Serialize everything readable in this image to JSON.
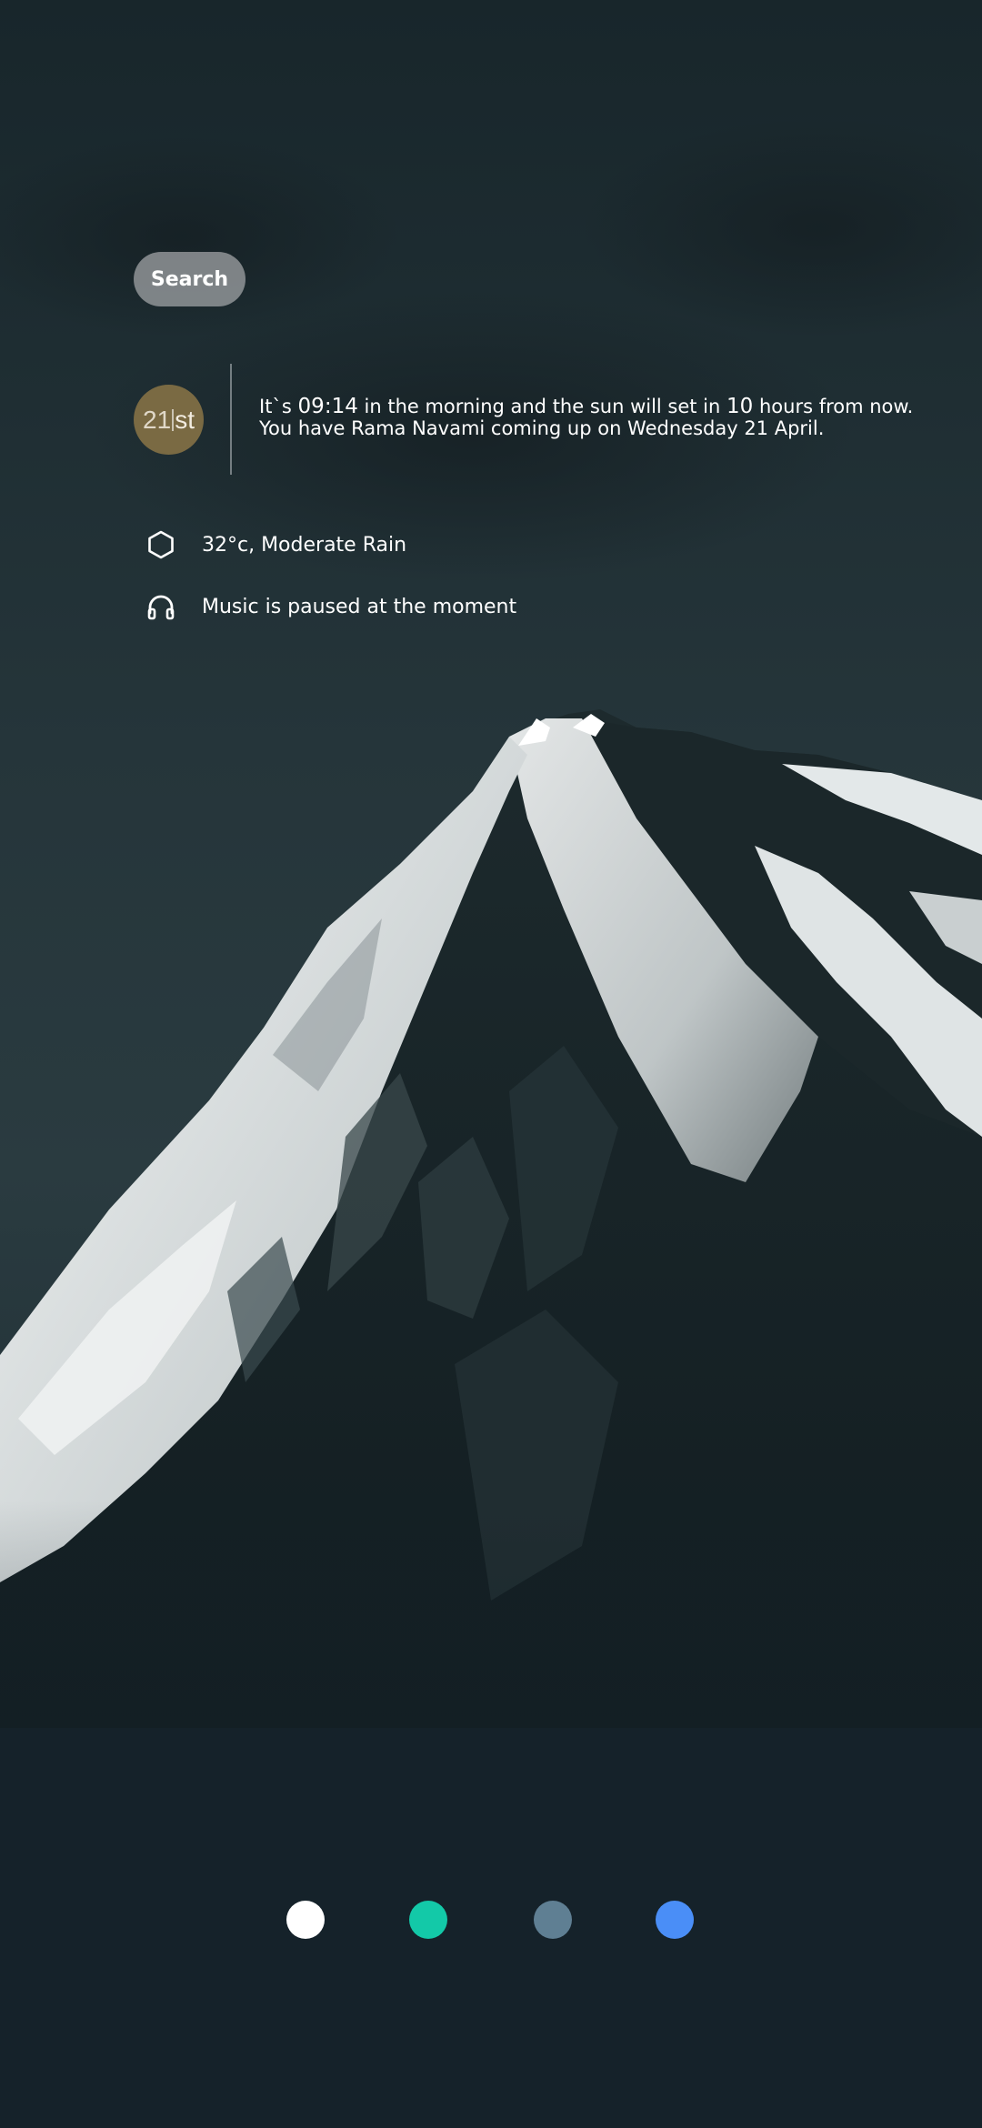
{
  "search": {
    "label": "Search"
  },
  "date_badge": {
    "number": "21",
    "suffix": "st",
    "color": "#7a6a43"
  },
  "summary": {
    "line1_prefix": "It`s ",
    "time": "09:14",
    "line1_mid": " in the morning and the sun will set in ",
    "hours": "10",
    "line1_suffix": " hours from now.",
    "line2": "You have Rama Navami coming up on Wednesday 21 April."
  },
  "weather": {
    "icon": "hexagon-icon",
    "text": "32°c, Moderate Rain"
  },
  "music": {
    "icon": "headphones-icon",
    "text": "Music is paused at the moment"
  },
  "color_dots": [
    {
      "name": "white",
      "color": "#ffffff"
    },
    {
      "name": "teal",
      "color": "#13c9a8"
    },
    {
      "name": "slate",
      "color": "#5f7f93"
    },
    {
      "name": "blue",
      "color": "#4a8ef7"
    }
  ]
}
